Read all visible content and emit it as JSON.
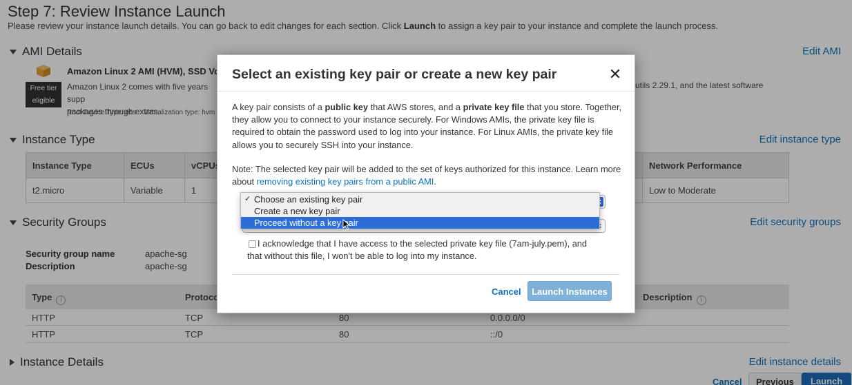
{
  "page": {
    "title": "Step 7: Review Instance Launch",
    "desc_before": "Please review your instance launch details. You can go back to edit changes for each section. Click ",
    "desc_bold": "Launch",
    "desc_after": " to assign a key pair to your instance and complete the launch process."
  },
  "ami": {
    "heading": "AMI Details",
    "edit": "Edit AMI",
    "name": "Amazon Linux 2 AMI (HVM), SSD Vo",
    "free_tier": "Free tier",
    "eligible": "eligible",
    "desc": "Amazon Linux 2 comes with five years supp",
    "desc2": "packages through extras.",
    "desc_right": "utils 2.29.1, and the latest software",
    "root_device": "Root Device Type: ebs",
    "virtualization": "Virtualization type: hvm"
  },
  "instance_type": {
    "heading": "Instance Type",
    "edit": "Edit instance type",
    "headers": [
      "Instance Type",
      "ECUs",
      "vCPUs",
      "Network Performance"
    ],
    "row": [
      "t2.micro",
      "Variable",
      "1",
      "Low to Moderate"
    ]
  },
  "security_groups": {
    "heading": "Security Groups",
    "edit": "Edit security groups",
    "name_label": "Security group name",
    "name_value": "apache-sg",
    "desc_label": "Description",
    "desc_value": "apache-sg",
    "headers": {
      "type": "Type",
      "protocol": "Protoco",
      "description": "Description"
    },
    "rows": [
      {
        "type": "HTTP",
        "protocol": "TCP",
        "port": "80",
        "source": "0.0.0.0/0"
      },
      {
        "type": "HTTP",
        "protocol": "TCP",
        "port": "80",
        "source": "::/0"
      }
    ]
  },
  "instance_details": {
    "heading": "Instance Details",
    "edit": "Edit instance details"
  },
  "footer": {
    "cancel": "Cancel",
    "previous": "Previous",
    "launch": "Launch"
  },
  "modal": {
    "title": "Select an existing key pair or create a new key pair",
    "close": "✕",
    "p1_a": "A key pair consists of a ",
    "p1_b": "public key",
    "p1_c": " that AWS stores, and a ",
    "p1_d": "private key file",
    "p1_e": " that you store. Together, they allow you to connect to your instance securely. For Windows AMIs, the private key file is required to obtain the password used to log into your instance. For Linux AMIs, the private key file allows you to securely SSH into your instance.",
    "note_a": "Note: The selected key pair will be added to the set of keys authorized for this instance. Learn more about ",
    "note_link": "removing existing key pairs from a public AMI",
    "note_b": ".",
    "dropdown": {
      "options": [
        "Choose an existing key pair",
        "Create a new key pair",
        "Proceed without a key pair"
      ],
      "checked_index": 0,
      "highlighted_index": 2,
      "check_mark": "✓"
    },
    "ack": "I acknowledge that I have access to the selected private key file (7am-july.pem), and that without this file, I won't be able to log into my instance.",
    "cancel": "Cancel",
    "launch": "Launch Instances"
  },
  "colors": {
    "link": "#0d74bd",
    "primary": "#1c6cb8",
    "highlight": "#2b6cd6",
    "disabled_primary": "#7fb0d8"
  }
}
